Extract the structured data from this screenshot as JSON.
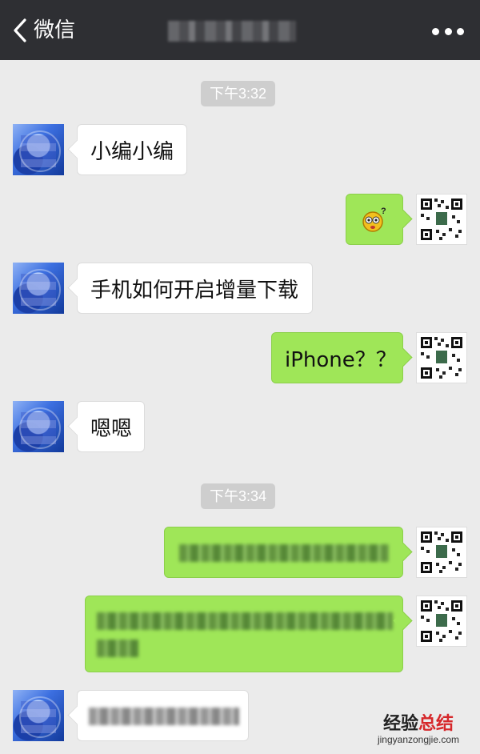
{
  "nav": {
    "back_label": "微信"
  },
  "messages": {
    "timestamp_1": "下午3:32",
    "msg_1": "小编小编",
    "msg_3": "手机如何开启增量下载",
    "msg_4": "iPhone？？",
    "msg_5": "嗯嗯",
    "timestamp_2": "下午3:34"
  },
  "watermark": {
    "main_part1": "经验",
    "main_part2": "总结",
    "sub": "jingyanzongjie.com"
  },
  "colors": {
    "nav_bg": "#2e2f33",
    "chat_bg": "#ebebeb",
    "sent_bubble": "#9fe658",
    "received_bubble": "#ffffff",
    "watermark_accent": "#d6282b"
  },
  "icons": [
    "back-chevron-icon",
    "more-dots-icon",
    "emoji-sticker-icon"
  ]
}
